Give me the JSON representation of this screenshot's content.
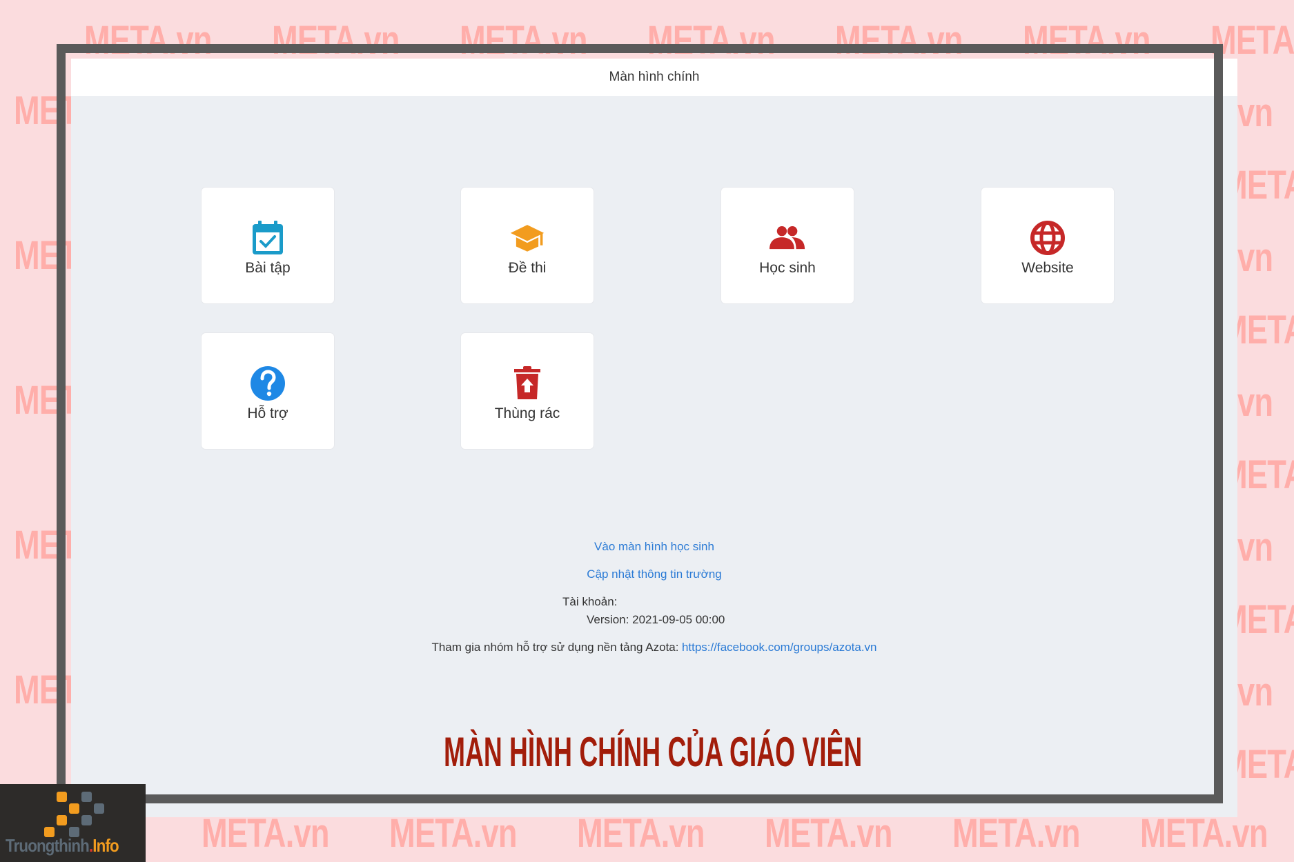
{
  "watermark": {
    "text": "META.vn",
    "brand": "META",
    "suffix": "vn",
    "color": "#ffaeaa"
  },
  "window": {
    "title": "Màn hình chính"
  },
  "tiles": [
    {
      "label": "Bài tập",
      "icon": "calendar-check-icon",
      "color": "#1a9bc9"
    },
    {
      "label": "Đề thi",
      "icon": "graduation-cap-icon",
      "color": "#f29c1f"
    },
    {
      "label": "Học sinh",
      "icon": "users-icon",
      "color": "#c62828"
    },
    {
      "label": "Website",
      "icon": "globe-icon",
      "color": "#c62828"
    },
    {
      "label": "Hỗ trợ",
      "icon": "help-circle-icon",
      "color": "#1e88e5"
    },
    {
      "label": "Thùng rác",
      "icon": "trash-restore-icon",
      "color": "#c62828"
    }
  ],
  "footer": {
    "student_screen_link": "Vào màn hình học sinh",
    "update_school_link": "Cập nhật thông tin trường",
    "account_label": "Tài khoản:",
    "version_text": "Version: 2021-09-05 00:00",
    "support_group_text": "Tham gia nhóm hỗ trợ sử dụng nền tảng Azota:",
    "support_group_link": "https://facebook.com/groups/azota.vn",
    "link_color": "#2a7ad5"
  },
  "caption": {
    "text": "MÀN HÌNH CHÍNH CỦA GIÁO VIÊN",
    "color": "#a21d0a"
  },
  "logo": {
    "name": "Truongthinh",
    "dot": ".",
    "suffix": "Info"
  }
}
